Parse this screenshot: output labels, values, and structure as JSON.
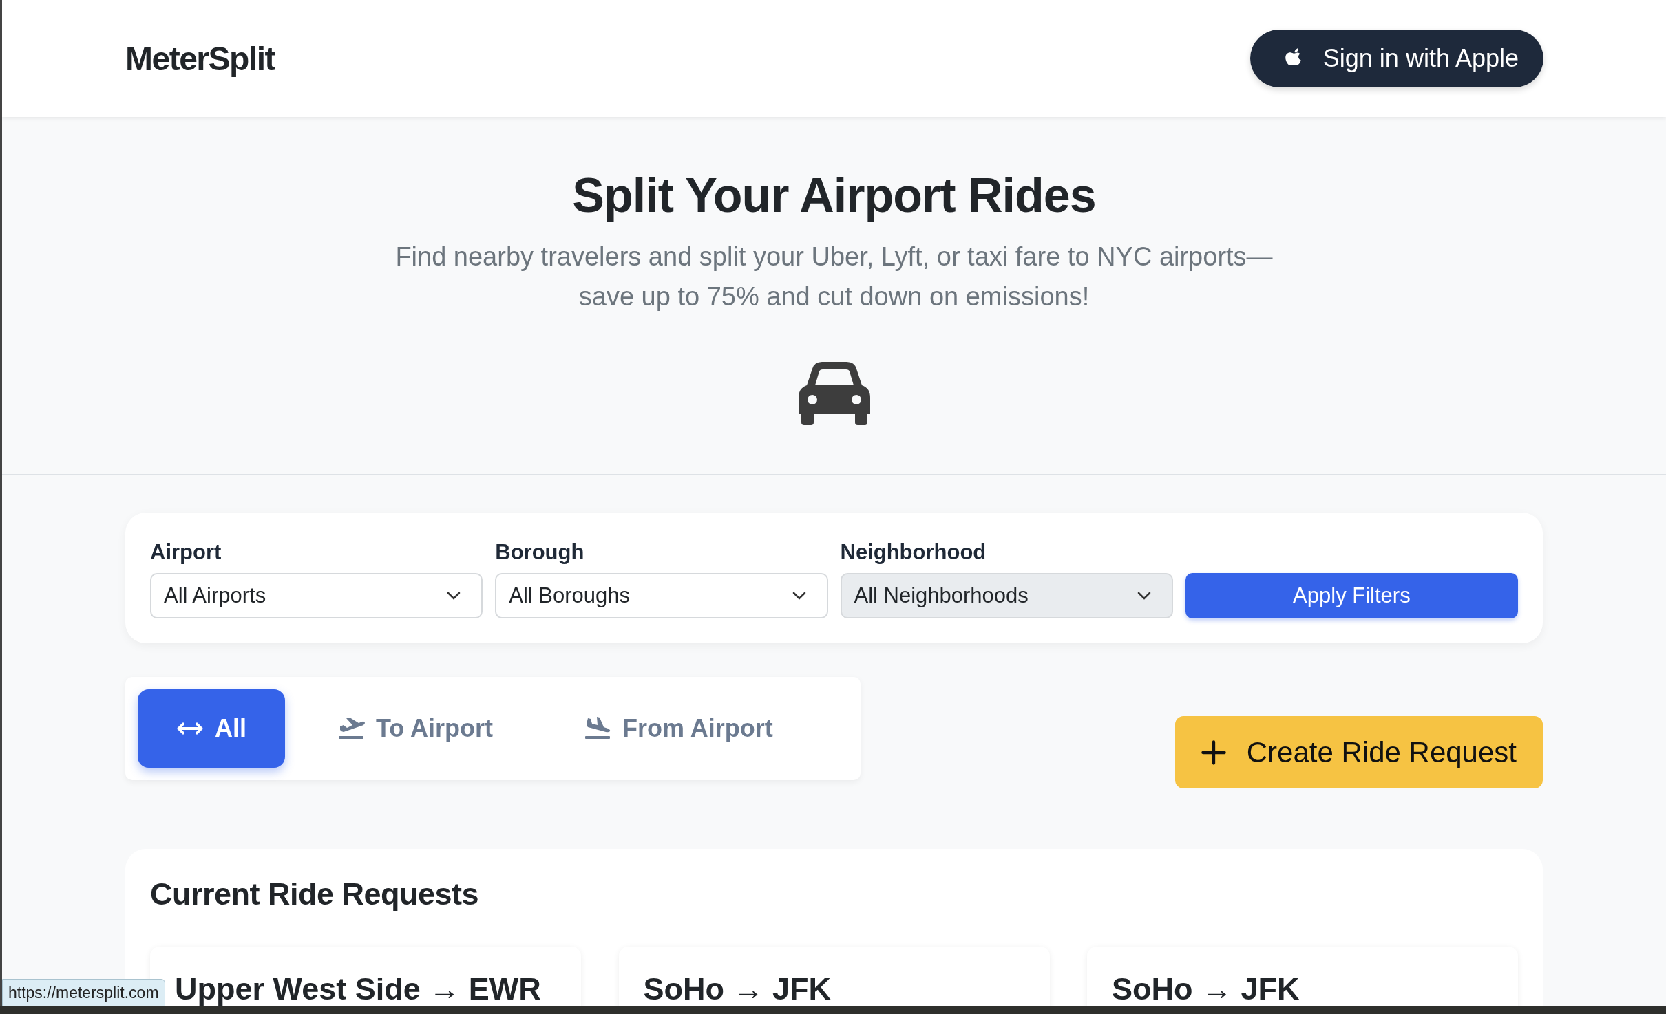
{
  "header": {
    "logo": "MeterSplit",
    "sign_in": "Sign in with Apple"
  },
  "hero": {
    "title": "Split Your Airport Rides",
    "subtitle_lines": [
      "Find nearby travelers and split your Uber, Lyft, or taxi fare to NYC airports—",
      "save up to 75% and cut down on emissions!"
    ]
  },
  "filters": [
    {
      "kind": "select",
      "label": "Airport",
      "value": "All Airports",
      "disabled": false
    },
    {
      "kind": "select",
      "label": "Borough",
      "value": "All Boroughs",
      "disabled": false
    },
    {
      "kind": "select",
      "label": "Neighborhood",
      "value": "All Neighborhoods",
      "disabled": true
    },
    {
      "kind": "button",
      "label": "Apply Filters"
    }
  ],
  "direction_tabs": [
    {
      "kind": "both",
      "label": "All",
      "selected": true
    },
    {
      "kind": "departure",
      "label": "To Airport",
      "selected": false
    },
    {
      "kind": "arrival",
      "label": "From Airport",
      "selected": false
    }
  ],
  "create_button": "Create Ride Request",
  "rides": {
    "title": "Current Ride Requests",
    "items": [
      {
        "title": "Upper West Side → EWR"
      },
      {
        "title": "SoHo → JFK"
      },
      {
        "title": "SoHo → JFK"
      }
    ]
  },
  "status_link": "https://metersplit.com"
}
